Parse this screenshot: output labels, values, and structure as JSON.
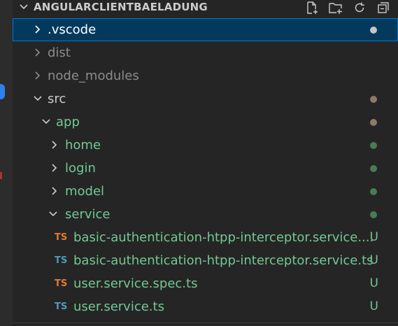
{
  "explorer": {
    "section_title": "ANGULARCLIENTBAELADUNG",
    "actions": [
      "new-file-icon",
      "new-folder-icon",
      "refresh-icon",
      "collapse-all-icon"
    ]
  },
  "colors": {
    "background": "#252526",
    "selected_bg": "#04395e",
    "untracked_green": "#73c991",
    "ts_blue": "#519aba",
    "ts_orange": "#e37933",
    "dot_brown": "#8c7b6a",
    "dot_green": "#4b7a55",
    "dot_gray": "#c5c5c5"
  },
  "tree": {
    "items": [
      {
        "label": ".vscode"
      },
      {
        "label": "dist"
      },
      {
        "label": "node_modules"
      },
      {
        "label": "src"
      },
      {
        "label": "app"
      },
      {
        "label": "home"
      },
      {
        "label": "login"
      },
      {
        "label": "model"
      },
      {
        "label": "service"
      },
      {
        "label": "basic-authentication-htpp-interceptor.service....",
        "badge": "TS",
        "status": "U"
      },
      {
        "label": "basic-authentication-htpp-interceptor.service.ts",
        "badge": "TS",
        "status": "U"
      },
      {
        "label": "user.service.spec.ts",
        "badge": "TS",
        "status": "U"
      },
      {
        "label": "user.service.ts",
        "badge": "TS",
        "status": "U"
      }
    ]
  }
}
